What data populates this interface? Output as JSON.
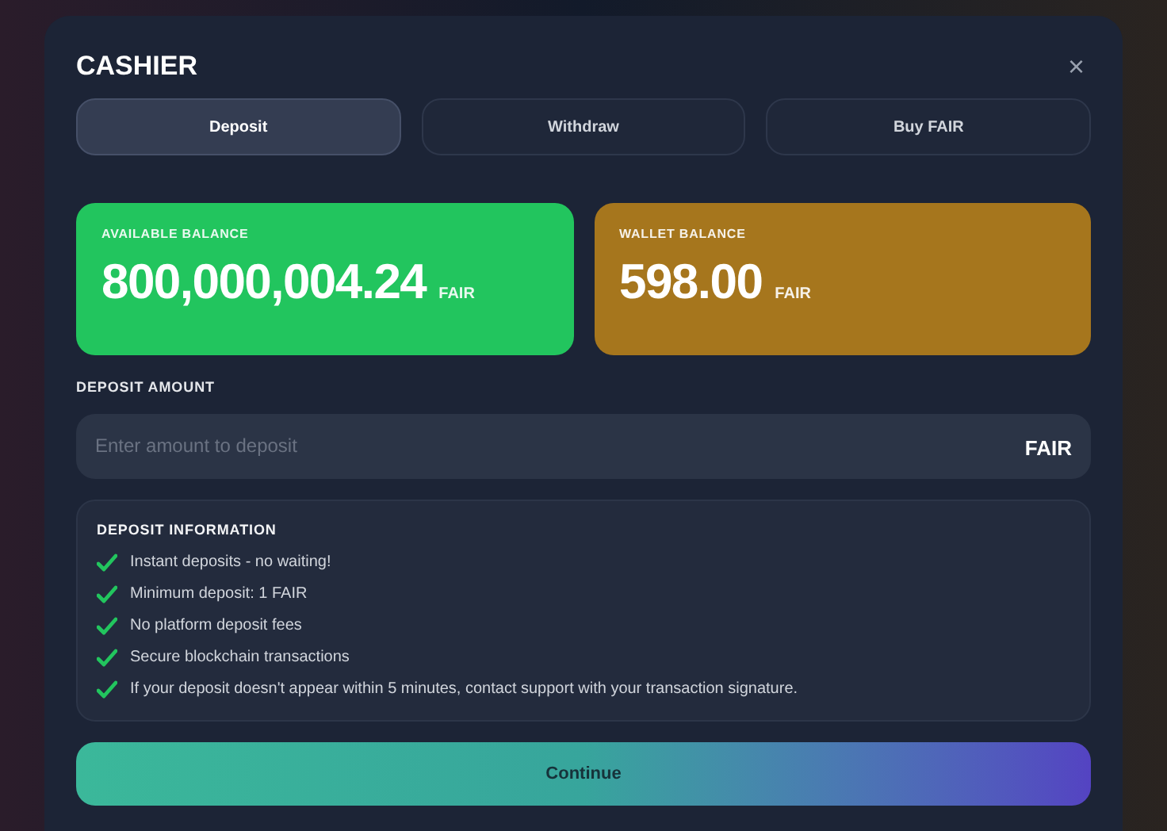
{
  "dialog": {
    "title": "CASHIER",
    "close": "×"
  },
  "tabs": [
    {
      "label": "Deposit",
      "selected": true
    },
    {
      "label": "Withdraw",
      "selected": false
    },
    {
      "label": "Buy FAIR",
      "selected": false
    }
  ],
  "balances": [
    {
      "label": "AVAILABLE BALANCE",
      "amount": "800,000,004.24",
      "unit": "FAIR",
      "color": "#22c55e"
    },
    {
      "label": "WALLET BALANCE",
      "amount": "598.00",
      "unit": "FAIR",
      "color": "#a6761d"
    }
  ],
  "deposit_amount": {
    "label": "DEPOSIT AMOUNT",
    "placeholder": "Enter amount to deposit",
    "unit": "FAIR"
  },
  "info": {
    "title": "DEPOSIT INFORMATION",
    "items": [
      "Instant deposits - no waiting!",
      "Minimum deposit: 1 FAIR",
      "No platform deposit fees",
      "Secure blockchain transactions",
      "If your deposit doesn't appear within 5 minutes, contact support with your transaction signature."
    ]
  },
  "continue_button": "Continue"
}
